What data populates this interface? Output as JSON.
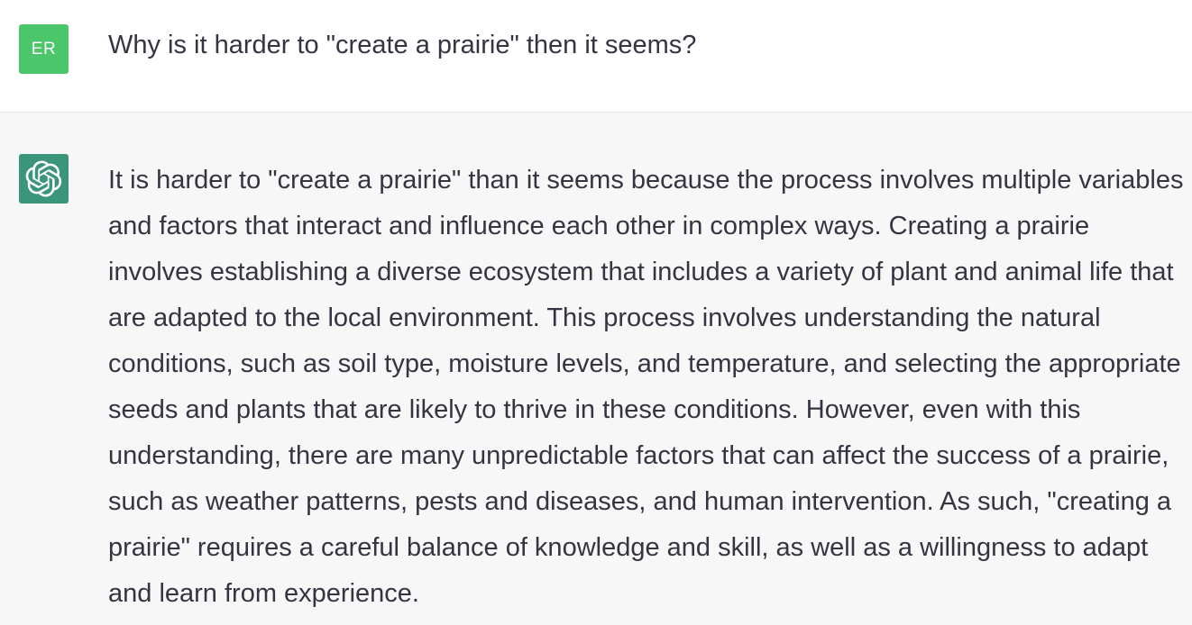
{
  "conversation": {
    "user": {
      "avatar_initials": "ER",
      "avatar_color": "#4cc66a",
      "message": "Why is it harder to \"create a prairie\" then it seems?"
    },
    "assistant": {
      "avatar_icon": "openai-logo-icon",
      "avatar_color": "#3a957a",
      "message": "It is harder to \"create a prairie\" than it seems because the process involves multiple variables and factors that interact and influence each other in complex ways. Creating a prairie involves establishing a diverse ecosystem that includes a variety of plant and animal life that are adapted to the local environment. This process involves understanding the natural conditions, such as soil type, moisture levels, and temperature, and selecting the appropriate seeds and plants that are likely to thrive in these conditions. However, even with this understanding, there are many unpredictable factors that can affect the success of a prairie, such as weather patterns, pests and diseases, and human intervention. As such, \"creating a prairie\" requires a careful balance of knowledge and skill, as well as a willingness to adapt and learn from experience."
    }
  }
}
